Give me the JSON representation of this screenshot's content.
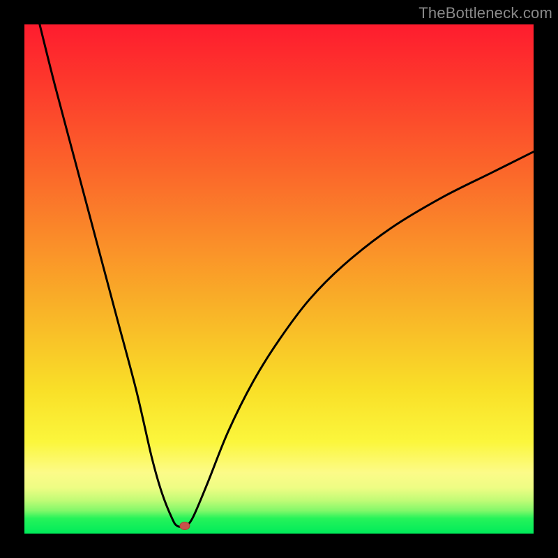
{
  "watermark": {
    "text": "TheBottleneck.com"
  },
  "chart_data": {
    "type": "line",
    "title": "",
    "xlabel": "",
    "ylabel": "",
    "xlim": [
      0,
      100
    ],
    "ylim": [
      0,
      100
    ],
    "grid": false,
    "legend": false,
    "series": [
      {
        "name": "bottleneck-curve",
        "x": [
          3,
          6,
          10,
          14,
          18,
          22,
          25,
          27,
          29,
          30,
          31.5,
          33,
          36,
          40,
          45,
          50,
          56,
          63,
          72,
          82,
          92,
          100
        ],
        "values": [
          100,
          88,
          73,
          58,
          43,
          28,
          15,
          8,
          3,
          1.5,
          1.5,
          3,
          10,
          20,
          30,
          38,
          46,
          53,
          60,
          66,
          71,
          75
        ]
      }
    ],
    "annotations": [
      {
        "name": "minimum-marker",
        "x": 31.5,
        "y": 1.5
      }
    ],
    "background_gradient": {
      "direction": "vertical",
      "stops": [
        {
          "pos": 0.0,
          "color": "#fe1c2e"
        },
        {
          "pos": 0.55,
          "color": "#f9b028"
        },
        {
          "pos": 0.85,
          "color": "#fcfb88"
        },
        {
          "pos": 1.0,
          "color": "#00eb5a"
        }
      ]
    }
  }
}
